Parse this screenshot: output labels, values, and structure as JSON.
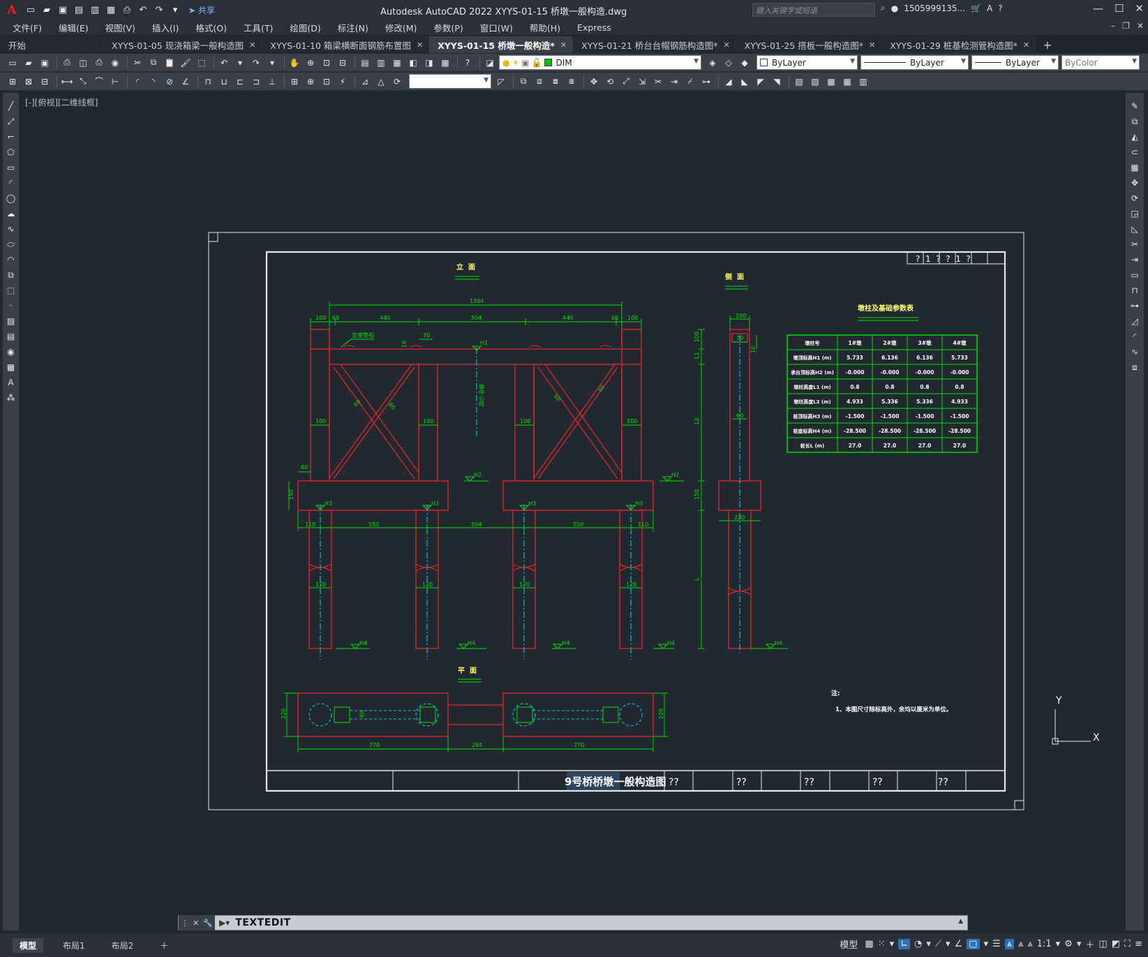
{
  "app": {
    "title": "Autodesk AutoCAD 2022    XYYS-01-15 桥墩一般构造.dwg",
    "search_placeholder": "键入关键字或短语",
    "user": "1505999135...",
    "share_label": "共享",
    "logo_letter": "A"
  },
  "menu": [
    "文件(F)",
    "编辑(E)",
    "视图(V)",
    "插入(I)",
    "格式(O)",
    "工具(T)",
    "绘图(D)",
    "标注(N)",
    "修改(M)",
    "参数(P)",
    "窗口(W)",
    "帮助(H)",
    "Express"
  ],
  "tabs": [
    {
      "label": "开始",
      "active": false,
      "closable": false
    },
    {
      "label": "XYYS-01-05 现浇箱梁一般构造图",
      "active": false,
      "closable": true
    },
    {
      "label": "XYYS-01-10 箱梁横断面钢筋布置图",
      "active": false,
      "closable": true
    },
    {
      "label": "XYYS-01-15 桥墩一般构造*",
      "active": true,
      "closable": true
    },
    {
      "label": "XYYS-01-21 桥台台帽钢筋构造图*",
      "active": false,
      "closable": true
    },
    {
      "label": "XYYS-01-25 搭板一般构造图*",
      "active": false,
      "closable": true
    },
    {
      "label": "XYYS-01-29 桩基检测管构造图*",
      "active": false,
      "closable": true
    }
  ],
  "properties": {
    "layer": "DIM",
    "color": "ByLayer",
    "linetype": "ByLayer",
    "lineweight": "ByLayer",
    "plotstyle": "ByColor",
    "layer_color": "#00c000"
  },
  "viewport": {
    "label": "[-][俯视][二维线框]"
  },
  "drawing": {
    "title_front": "立  面",
    "title_side": "侧  面",
    "title_plan": "平  面",
    "table_title": "墩柱及基础参数表",
    "sheet_title": "9号桥桥墩一般构造图",
    "sheet_cells": [
      "??",
      "??",
      "??",
      "??",
      "??"
    ],
    "corner_box": "?  1  ?  ?  1  ?",
    "notes_title": "注:",
    "notes_text": "1、本图尺寸除标高外，余均以厘米为单位。",
    "leader_label": "支座垫石",
    "center_label": "墩中心线",
    "table": {
      "header": [
        "墩柱号",
        "1#墩",
        "2#墩",
        "3#墩",
        "4#墩"
      ],
      "rows": [
        [
          "墩顶标高H1 (m)",
          "5.733",
          "6.136",
          "6.136",
          "5.733"
        ],
        [
          "承台顶标高H2 (m)",
          "-0.000",
          "-0.000",
          "-0.000",
          "-0.000"
        ],
        [
          "墩柱高度L1 (m)",
          "0.8",
          "0.8",
          "0.8",
          "0.8"
        ],
        [
          "墩柱高度L2 (m)",
          "4.933",
          "5.336",
          "5.336",
          "4.933"
        ],
        [
          "桩顶标高H3 (m)",
          "-1.500",
          "-1.500",
          "-1.500",
          "-1.500"
        ],
        [
          "桩底标高H4 (m)",
          "-28.500",
          "-28.500",
          "-28.500",
          "-28.500"
        ],
        [
          "桩长L (m)",
          "27.0",
          "27.0",
          "27.0",
          "27.0"
        ]
      ]
    },
    "dims_front": {
      "total": "1504",
      "top": [
        "100",
        "60",
        "440",
        "504",
        "440",
        "60",
        "100"
      ],
      "small": [
        "70",
        "10"
      ],
      "col": [
        "100",
        "100",
        "100",
        "100"
      ],
      "brace": [
        "60",
        "60",
        "60",
        "60"
      ],
      "cap_left": "60",
      "cap_h": "150",
      "pile": [
        "110",
        "550",
        "504",
        "550",
        "110"
      ],
      "pile_d": [
        "120",
        "120",
        "120",
        "120"
      ],
      "elev": [
        "H1",
        "H2",
        "H2",
        "H3",
        "H3",
        "H3",
        "H3",
        "H4",
        "H4",
        "H4",
        "H4"
      ]
    },
    "dims_side": {
      "top": "100",
      "inner": [
        "70",
        "10"
      ],
      "col": "60",
      "cap": "220",
      "v": [
        "100",
        "L1",
        "L2",
        "150",
        "L"
      ],
      "elev": [
        "H4"
      ]
    },
    "dims_plan": {
      "w": [
        "770",
        "284",
        "770"
      ],
      "h": [
        "220",
        "220"
      ],
      "col": "80"
    },
    "ucs": {
      "x": "X",
      "y": "Y"
    }
  },
  "command": {
    "text": "TEXTEDIT"
  },
  "status": {
    "layout_tabs": [
      "模型",
      "布局1",
      "布局2"
    ],
    "model_label": "模型",
    "scale": "1:1"
  }
}
